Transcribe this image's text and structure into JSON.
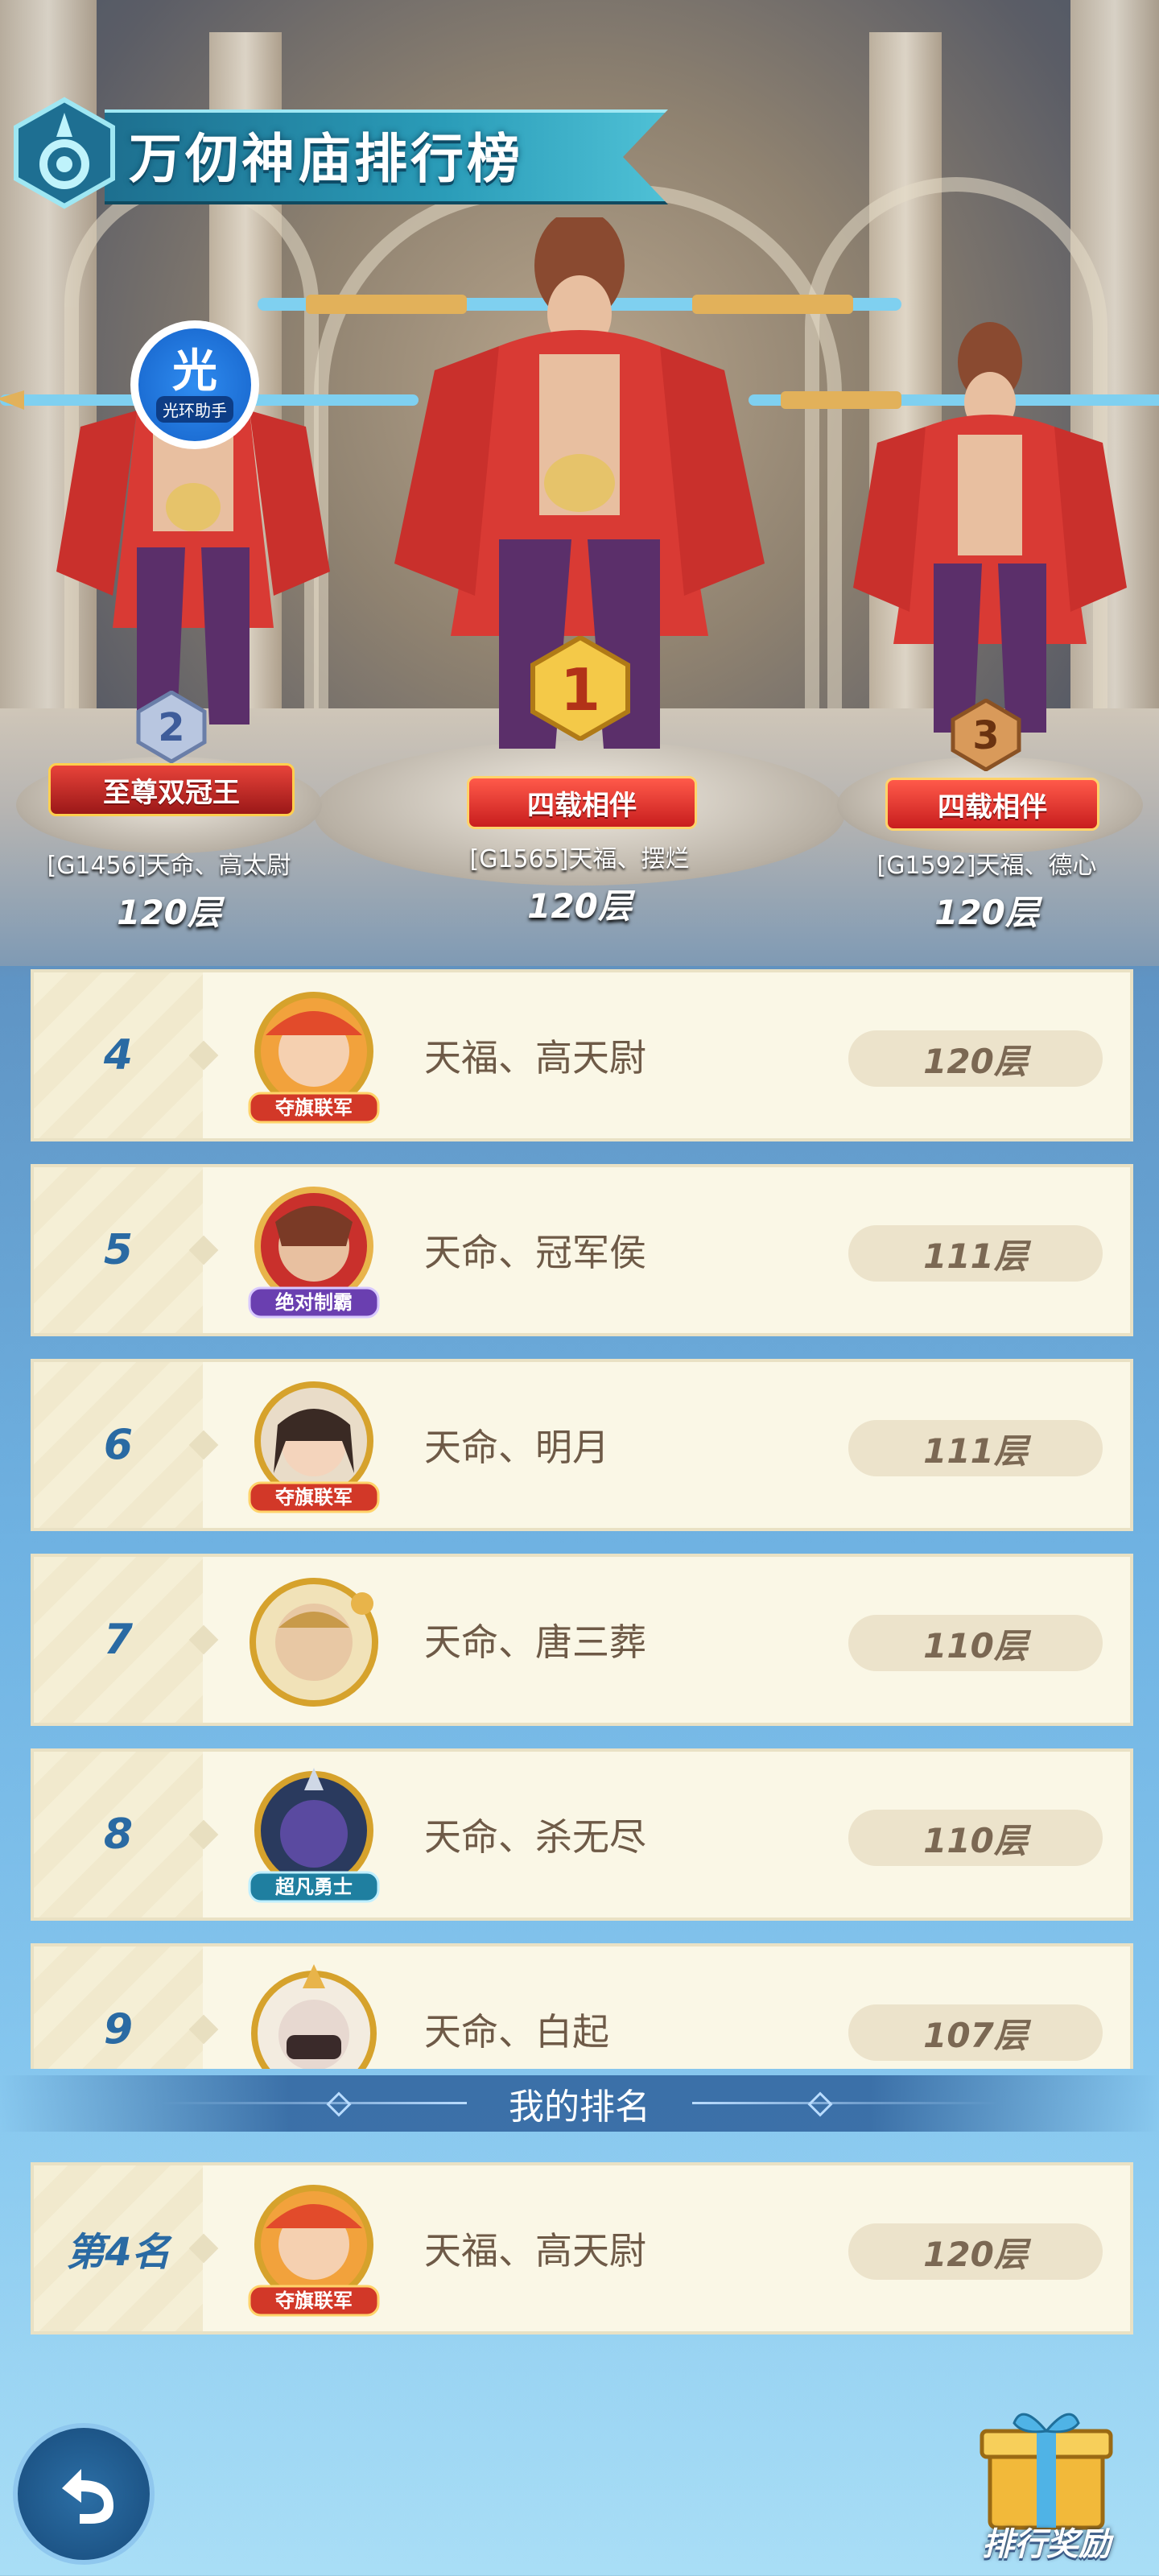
{
  "title": "万仞神庙排行榜",
  "helper_badge": {
    "big": "光",
    "small": "光环助手"
  },
  "top3": [
    {
      "rank": "2",
      "badge": "至尊双冠王",
      "name": "[G1456]天命、高太尉",
      "floor": "120层"
    },
    {
      "rank": "1",
      "badge": "四载相伴",
      "name": "[G1565]天福、摆烂",
      "floor": "120层"
    },
    {
      "rank": "3",
      "badge": "四载相伴",
      "name": "[G1592]天福、德心",
      "floor": "120层"
    }
  ],
  "rankings": [
    {
      "rank": "4",
      "badge": "夺旗联军",
      "name": "天福、高天尉",
      "floor": "120层"
    },
    {
      "rank": "5",
      "badge": "绝对制霸",
      "name": "天命、冠军侯",
      "floor": "111层"
    },
    {
      "rank": "6",
      "badge": "夺旗联军",
      "name": "天命、明月",
      "floor": "111层"
    },
    {
      "rank": "7",
      "badge": "",
      "name": "天命、唐三葬",
      "floor": "110层"
    },
    {
      "rank": "8",
      "badge": "超凡勇士",
      "name": "天命、杀无尽",
      "floor": "110层"
    },
    {
      "rank": "9",
      "badge": "",
      "name": "天命、白起",
      "floor": "107层"
    }
  ],
  "my_rank": {
    "header": "我的排名",
    "rank": "第4名",
    "badge": "夺旗联军",
    "name": "天福、高天尉",
    "floor": "120层"
  },
  "buttons": {
    "reward": "排行奖励"
  },
  "icons": {
    "back": "back-arrow-icon",
    "reward": "gift-box-icon"
  }
}
